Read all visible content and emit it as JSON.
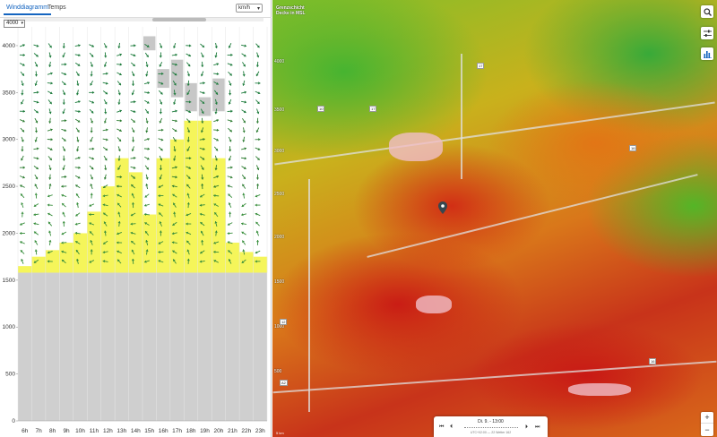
{
  "tabs": [
    {
      "label": "Winddiagramm",
      "active": true
    },
    {
      "label": "Temps",
      "active": false
    }
  ],
  "unit": {
    "selected": "km/h"
  },
  "altitude": {
    "selected": "4000"
  },
  "chart_data": {
    "type": "wind-profile",
    "hours": [
      "6h",
      "7h",
      "8h",
      "9h",
      "10h",
      "11h",
      "12h",
      "13h",
      "14h",
      "15h",
      "16h",
      "17h",
      "18h",
      "19h",
      "20h",
      "21h",
      "22h",
      "23h"
    ],
    "y_ticks": [
      0,
      500,
      1000,
      1500,
      2000,
      2500,
      3000,
      3500,
      4000
    ],
    "ylim": [
      0,
      4200
    ],
    "terrain_top_m": 1580,
    "boundary_layer_m": [
      1650,
      1750,
      1820,
      1900,
      2000,
      2230,
      2500,
      2800,
      2650,
      2200,
      2800,
      3000,
      3200,
      3200,
      2800,
      1900,
      1800,
      1750
    ],
    "cloud_cells": [
      {
        "hour_index": 9,
        "from_m": 3950,
        "to_m": 4100
      },
      {
        "hour_index": 10,
        "from_m": 3550,
        "to_m": 3750
      },
      {
        "hour_index": 11,
        "from_m": 3450,
        "to_m": 3850
      },
      {
        "hour_index": 12,
        "from_m": 3300,
        "to_m": 3600
      },
      {
        "hour_index": 13,
        "from_m": 3250,
        "to_m": 3450
      },
      {
        "hour_index": 14,
        "from_m": 3300,
        "to_m": 3650
      }
    ],
    "wind_levels_m": [
      4000,
      3900,
      3800,
      3700,
      3600,
      3500,
      3400,
      3300,
      3200,
      3100,
      3000,
      2900,
      2800,
      2700,
      2600,
      2500,
      2400,
      2300,
      2200,
      2100,
      2000,
      1900,
      1800,
      1700
    ]
  },
  "map": {
    "title": "Grenzschicht Decke in MSL",
    "contour_labels": [
      "4000",
      "3500",
      "3000",
      "2500",
      "2000",
      "1500",
      "1000",
      "500"
    ],
    "roads": [
      "17",
      "10",
      "16",
      "16",
      "17",
      "12",
      "A2"
    ],
    "time_label": "Di. 9. - 13:00",
    "time_sub": "UTC+02:00 — 22 Wetter 162",
    "scale": "5 km",
    "zoom_in": "+",
    "zoom_out": "−"
  },
  "icons": {
    "search": "search-icon",
    "settings": "sliders-icon",
    "chart": "bar-chart-icon",
    "marker": "map-pin-icon"
  }
}
